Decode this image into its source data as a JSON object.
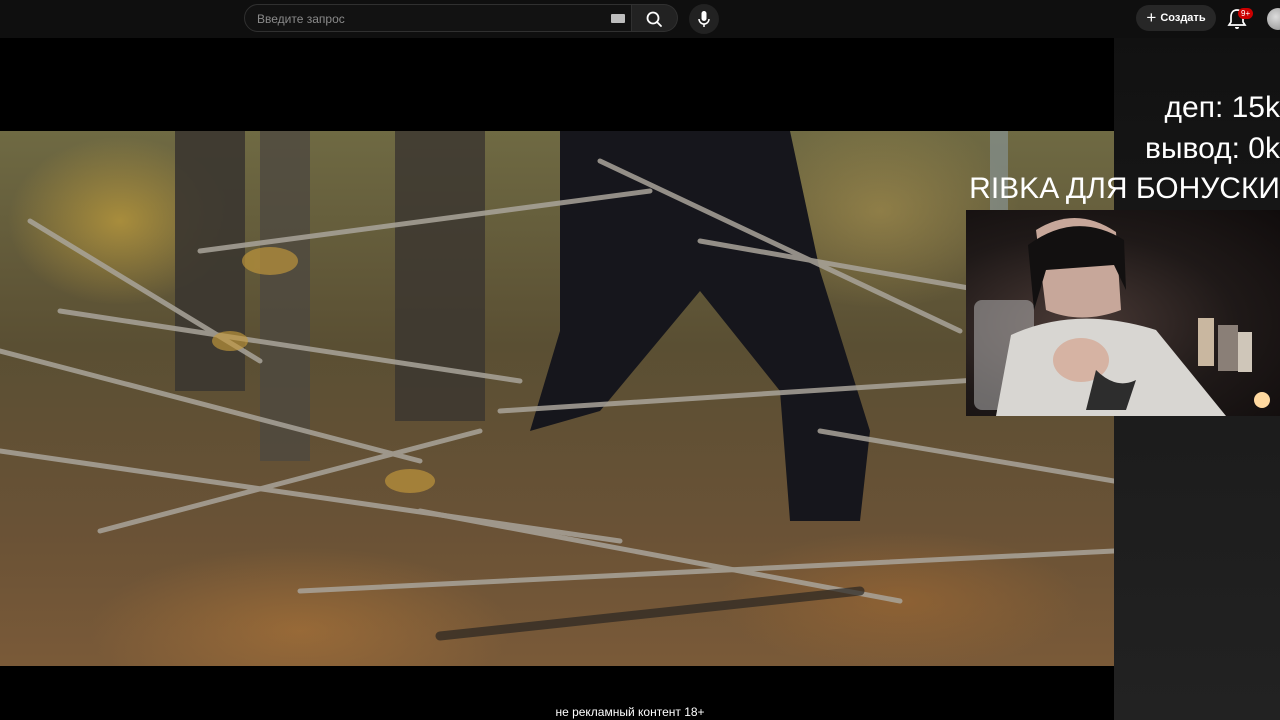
{
  "header": {
    "search": {
      "placeholder": "Введите запрос"
    },
    "icons": {
      "keyboard": "keyboard-icon",
      "search": "search-icon",
      "mic": "mic-icon",
      "bell": "bell-icon",
      "plus": "plus-icon"
    },
    "create_label": "Создать",
    "notifications_badge": "9+"
  },
  "stream_overlay": {
    "line1": "деп: 15k",
    "line2": "вывод: 0k",
    "line3": "RIBKA ДЛЯ БОНУСКИ"
  },
  "caption": "не рекламный контент 18+",
  "colors": {
    "topbar": "#0f0f0f",
    "badge": "#cc0000",
    "background": "#000000"
  }
}
